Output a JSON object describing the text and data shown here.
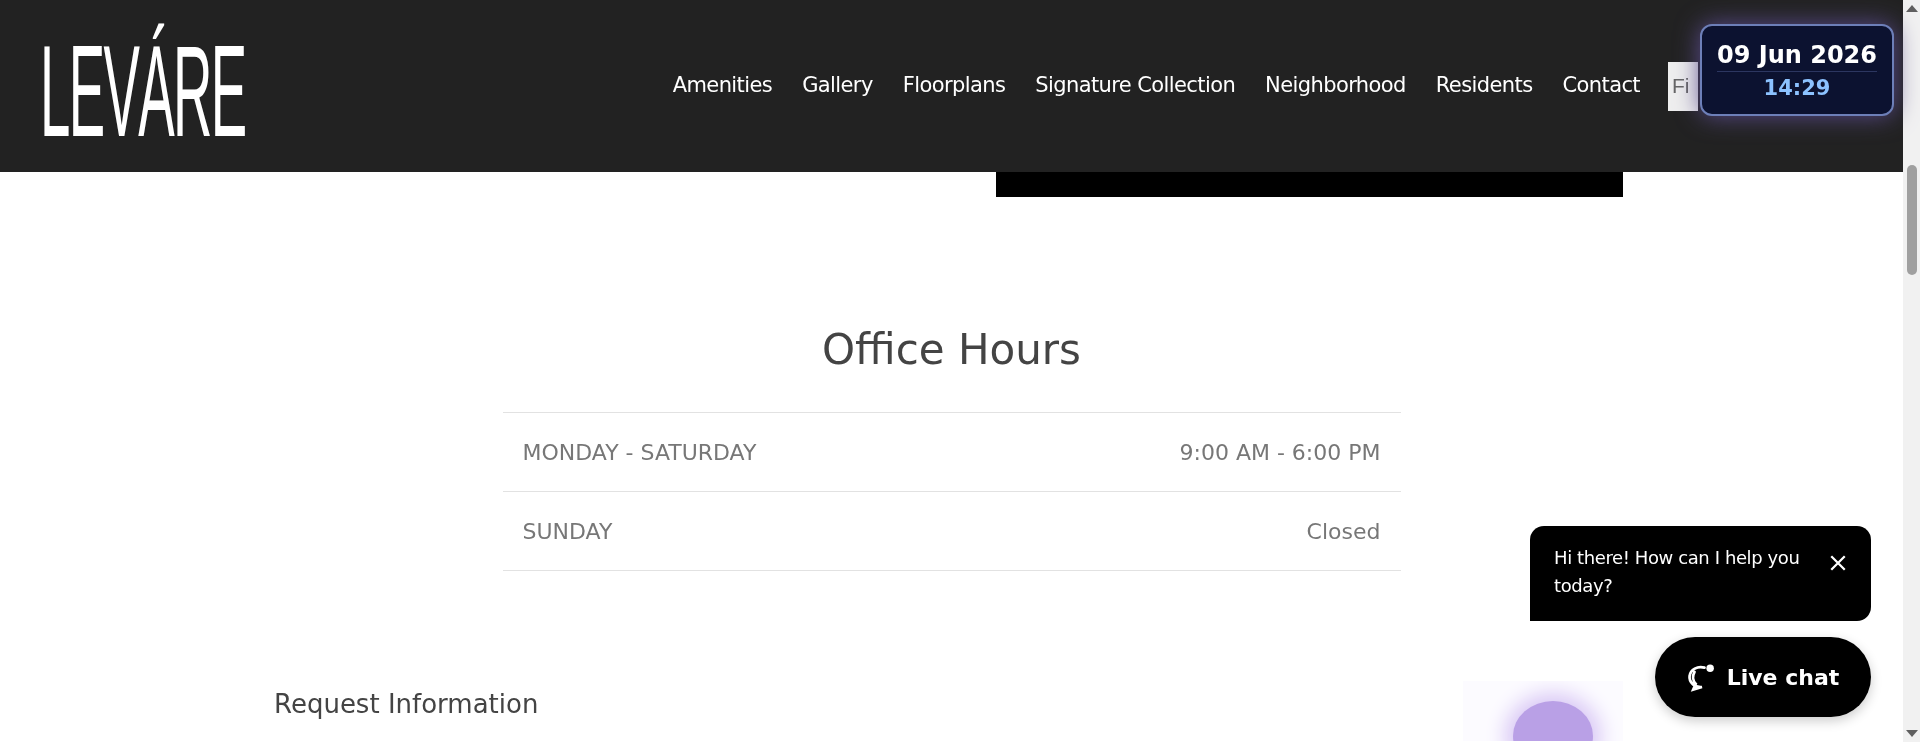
{
  "header": {
    "logo": "LEVÁRE",
    "nav": [
      {
        "label": "Amenities"
      },
      {
        "label": "Gallery"
      },
      {
        "label": "Floorplans"
      },
      {
        "label": "Signature Collection"
      },
      {
        "label": "Neighborhood"
      },
      {
        "label": "Residents"
      },
      {
        "label": "Contact"
      }
    ],
    "search": {
      "placeholder": "Fi"
    }
  },
  "clock_widget": {
    "date": "09 Jun 2026",
    "time": "14:29"
  },
  "office_hours": {
    "title": "Office Hours",
    "rows": [
      {
        "days": "MONDAY - SATURDAY",
        "hours": "9:00 AM - 6:00 PM"
      },
      {
        "days": "SUNDAY",
        "hours": "Closed"
      }
    ]
  },
  "request_info": {
    "title": "Request Information"
  },
  "chat": {
    "message": "Hi there! How can I help you today?",
    "button": "Live chat"
  }
}
